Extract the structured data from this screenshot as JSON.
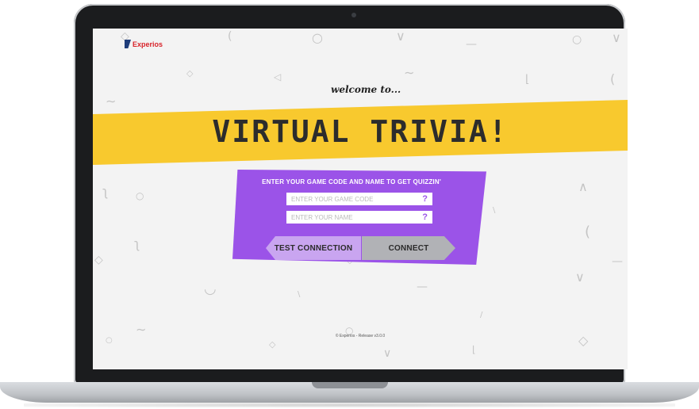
{
  "brand": {
    "logo_text": "Experios",
    "logo_color": "#d8232a"
  },
  "hero": {
    "welcome": "welcome to...",
    "title": "VIRTUAL TRIVIA!"
  },
  "form": {
    "prompt": "ENTER YOUR GAME CODE AND NAME TO GET QUIZZIN'",
    "game_code_placeholder": "ENTER YOUR GAME CODE",
    "name_placeholder": "ENTER YOUR NAME",
    "help_glyph": "?"
  },
  "buttons": {
    "test_connection": "TEST CONNECTION",
    "connect": "CONNECT"
  },
  "footer": {
    "text": "© Experios - Release v3.0.0"
  },
  "colors": {
    "banner": "#f8c92e",
    "card": "#9b53e8",
    "test_button": "#c9a5f0",
    "connect_button": "#b1b2b6",
    "background": "#f3f3f3"
  },
  "decorations": {
    "glyphs": [
      "○",
      "◇",
      "⌒",
      "∧",
      "∨",
      "∼",
      "(",
      "⟨",
      "□",
      "—",
      "◁"
    ]
  }
}
